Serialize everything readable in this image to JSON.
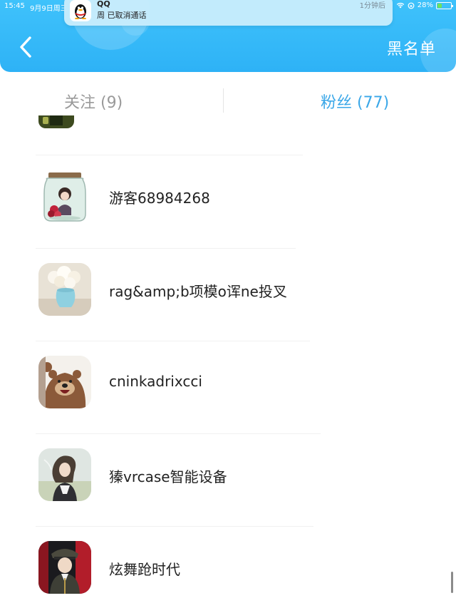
{
  "status_bar": {
    "time": "15:45",
    "date": "9月9日周三",
    "battery": "28%"
  },
  "notification": {
    "app": "QQ",
    "message": "周 已取消通话",
    "time": "1分钟后"
  },
  "header": {
    "back_icon": "chevron-left-icon",
    "right_label": "黑名单"
  },
  "tabs": {
    "following": "关注 (9)",
    "fans": "粉丝 (77)"
  },
  "fans_list": [
    {
      "name": "游客68984268",
      "avatar": "girl-in-jar"
    },
    {
      "name": "rag&amp;b项模o诨ne投叉",
      "avatar": "white-flowers-vase"
    },
    {
      "name": "cninkadrixcci",
      "avatar": "cartoon-bear"
    },
    {
      "name": "獉vrcase智能设备",
      "avatar": "girl-photo"
    },
    {
      "name": "炫舞跄时代",
      "avatar": "anime-officer"
    }
  ],
  "colors": {
    "header_bg": "#2eb2f6",
    "tab_active": "#3aa7e8",
    "tab_inactive": "#9a9a9a"
  }
}
